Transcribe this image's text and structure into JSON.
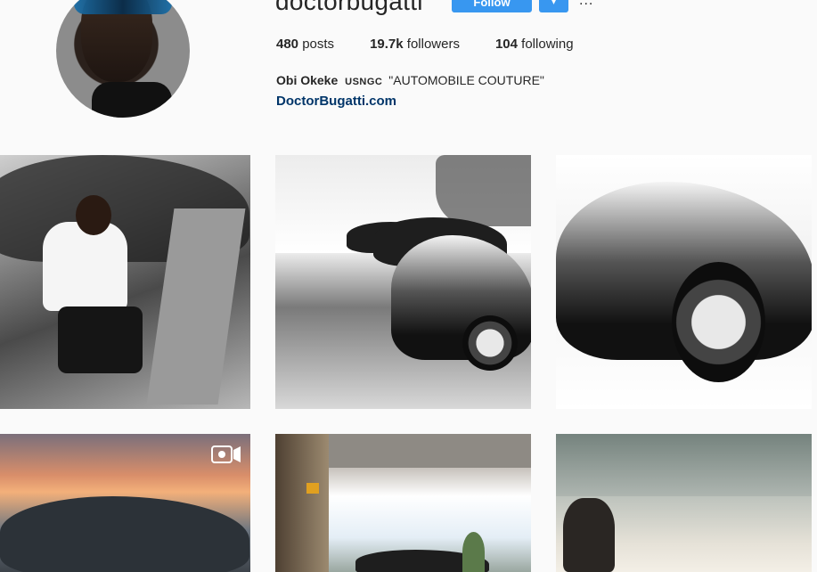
{
  "profile": {
    "username": "doctorbugatti",
    "follow_label": "Follow",
    "dropdown_icon": "chevron-down-icon",
    "more_label": "...",
    "stats": {
      "posts_count": "480",
      "posts_label": "posts",
      "followers_count": "19.7k",
      "followers_label": "followers",
      "following_count": "104",
      "following_label": "following"
    },
    "bio": {
      "name": "Obi Okeke",
      "tag": "USNGC",
      "quote": "\"AUTOMOBILE COUTURE\""
    },
    "website": "DoctorBugatti.com"
  },
  "colors": {
    "accent": "#3897f0",
    "link": "#003569",
    "background": "#fafafa"
  },
  "posts": [
    {
      "icon": "photo-icon",
      "video": false
    },
    {
      "icon": "photo-icon",
      "video": false
    },
    {
      "icon": "photo-icon",
      "video": false
    },
    {
      "icon": "photo-icon",
      "video": true
    },
    {
      "icon": "photo-icon",
      "video": false
    },
    {
      "icon": "photo-icon",
      "video": false
    }
  ]
}
